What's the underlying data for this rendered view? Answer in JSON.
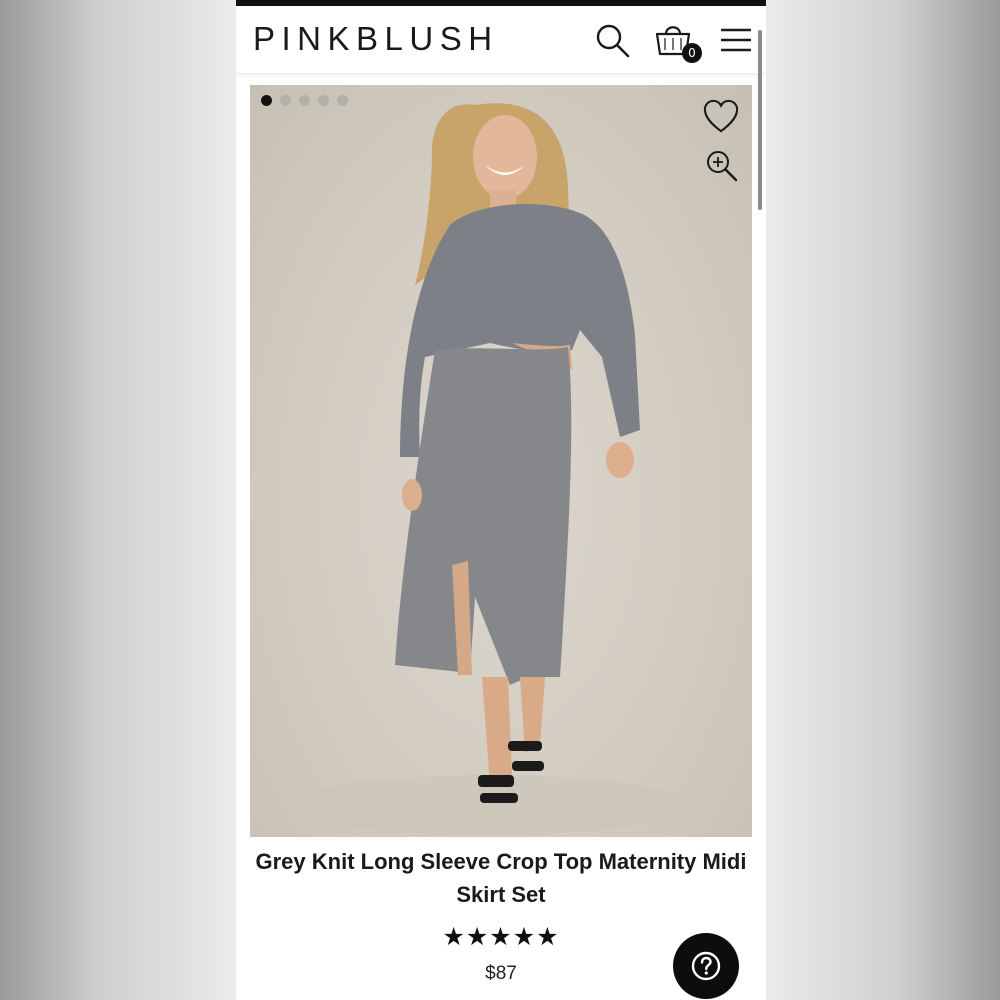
{
  "header": {
    "brand": "PINKBLUSH",
    "cart_count": "0",
    "icons": [
      "search-icon",
      "shopping-bag-icon",
      "hamburger-menu-icon"
    ]
  },
  "gallery": {
    "image_count": 5,
    "active_index": 0,
    "icons": [
      "heart-icon",
      "zoom-in-icon"
    ],
    "image_description": "model wearing grey knit crop top and midi skirt"
  },
  "product": {
    "title": "Grey Knit Long Sleeve Crop Top Maternity Midi Skirt Set",
    "rating_stars": "★★★★★",
    "rating": 5,
    "price": "$87"
  },
  "help": {
    "icon": "help-question-icon"
  },
  "colors": {
    "accent": "#111111",
    "background": "#ffffff"
  }
}
